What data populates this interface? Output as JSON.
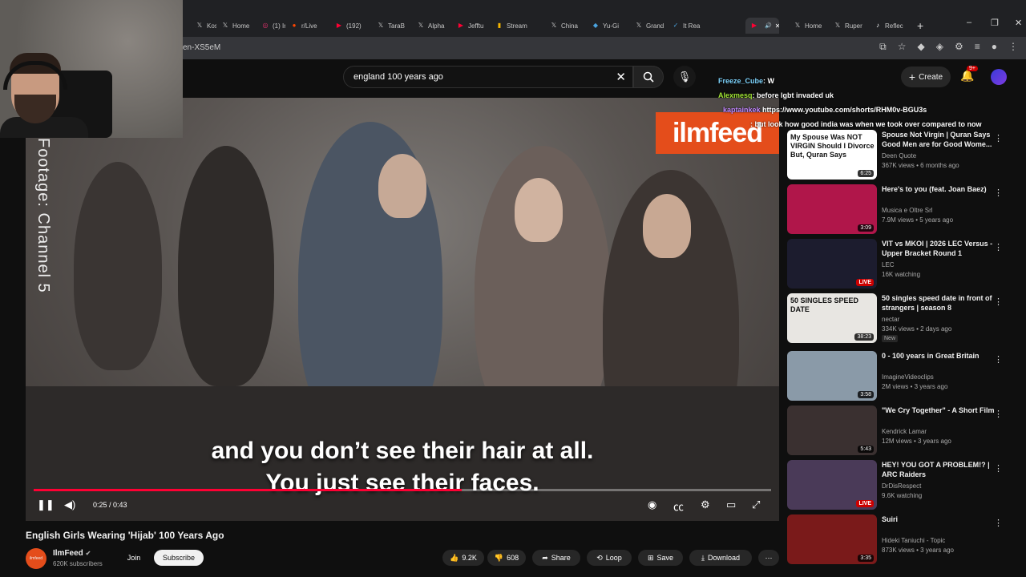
{
  "browser": {
    "tabs": [
      {
        "label": "Koshe",
        "icon": "x-logo-icon",
        "color": "#cccccc"
      },
      {
        "label": "Home",
        "icon": "x-logo-icon",
        "color": "#cccccc"
      },
      {
        "label": "(1) Ins",
        "icon": "instagram-icon",
        "color": "#e1306c"
      },
      {
        "label": "r/Live",
        "icon": "reddit-icon",
        "color": "#ff4500"
      },
      {
        "label": "(192)",
        "icon": "youtube-icon",
        "color": "#ff0033"
      },
      {
        "label": "TaraB",
        "icon": "x-logo-icon",
        "color": "#cccccc"
      },
      {
        "label": "Alpha",
        "icon": "x-logo-icon",
        "color": "#cccccc"
      },
      {
        "label": "Jefftu",
        "icon": "youtube-icon",
        "color": "#ff0033"
      },
      {
        "label": "Stream",
        "icon": "chart-icon",
        "color": "#f4b400"
      },
      {
        "label": "China",
        "icon": "x-logo-icon",
        "color": "#cccccc"
      },
      {
        "label": "Yu-Gi",
        "icon": "yugioh-icon",
        "color": "#4aa3df"
      },
      {
        "label": "Grand",
        "icon": "x-logo-icon",
        "color": "#cccccc"
      },
      {
        "label": "It Rea",
        "icon": "check-icon",
        "color": "#4aa3df"
      },
      {
        "label": "",
        "icon": "youtube-icon",
        "color": "#ff0033",
        "active": true
      },
      {
        "label": "Home",
        "icon": "x-logo-icon",
        "color": "#cccccc"
      },
      {
        "label": "Ruper",
        "icon": "x-logo-icon",
        "color": "#cccccc"
      },
      {
        "label": "Reflec",
        "icon": "tiktok-icon",
        "color": "#ffffff"
      }
    ],
    "new_tab": "+",
    "url_fragment": "en-XS5eM"
  },
  "header": {
    "search_value": "england 100 years ago",
    "create_label": "Create",
    "notification_count": "9+"
  },
  "chat": [
    {
      "user": "Freeze_Cube",
      "message": ": W",
      "user_color": "#7dd3fc"
    },
    {
      "user": "Alexmesq",
      "message": ": before lgbt invaded uk",
      "user_color": "#a3e635"
    },
    {
      "user": "kaptainkek",
      "message": "https://www.youtube.com/shorts/RHM0v-BGU3s",
      "user_color": "#c084fc"
    },
    {
      "user": "",
      "message": ": but look how good india was when we took over compared to now",
      "user_color": "#ffffff"
    }
  ],
  "video": {
    "watermark": "ilmfeed",
    "side_text": "Footage: Channel 5",
    "caption_line1": "and you don’t see their hair at all.",
    "caption_line2": "You just see their faces.",
    "time": "0:25 / 0:43",
    "progress": 0.58
  },
  "details": {
    "title": "English Girls Wearing 'Hijab' 100 Years Ago",
    "channel": "IlmFeed",
    "avatar_text": "ilmfeed",
    "subscribers": "620K subscribers",
    "join_label": "Join",
    "subscribe_label": "Subscribe",
    "likes": "9.2K",
    "dislikes": "608",
    "share_label": "Share",
    "loop_label": "Loop",
    "save_label": "Save",
    "download_label": "Download"
  },
  "recommendations": [
    {
      "title": "Spouse Not Virgin | Quran Says Good Men are for Good Wome...",
      "channel": "Deen Quote",
      "meta": "367K views • 6 months ago",
      "duration": "6:25",
      "thumb_text": "My Spouse Was NOT VIRGIN Should I Divorce But, Quran Says",
      "thumb_color": "#ffffff"
    },
    {
      "title": "Here's to you (feat. Joan Baez)",
      "channel": "Musica e Oltre Srl",
      "meta": "7.9M views • 5 years ago",
      "duration": "3:09",
      "thumb_text": "",
      "thumb_color": "#b0164a"
    },
    {
      "title": "VIT vs MKOI | 2026 LEC Versus - Upper Bracket Round 1",
      "channel": "LEC",
      "meta": "16K watching",
      "live": "LIVE",
      "thumb_text": "",
      "thumb_color": "#1c1c2e"
    },
    {
      "title": "50 singles speed date in front of strangers | season 8",
      "channel": "nectar",
      "meta": "334K views • 2 days ago",
      "badge": "New",
      "duration": "38:23",
      "thumb_text": "50 SINGLES SPEED DATE",
      "thumb_color": "#e8e6e2"
    },
    {
      "title": "0 - 100 years in Great Britain",
      "channel": "ImagineVideoclips",
      "meta": "2M views • 3 years ago",
      "duration": "3:58",
      "thumb_text": "",
      "thumb_color": "#8a9aa8"
    },
    {
      "title": "\"We Cry Together\" - A Short Film",
      "channel": "Kendrick Lamar",
      "meta": "12M views • 3 years ago",
      "duration": "5:43",
      "thumb_text": "",
      "thumb_color": "#3a3030"
    },
    {
      "title": "HEY! YOU GOT A PROBLEM!? | ARC Raiders",
      "channel": "DrDisRespect",
      "meta": "9.6K watching",
      "live": "LIVE",
      "thumb_text": "",
      "thumb_color": "#4a3a58"
    },
    {
      "title": "Suiri",
      "channel": "Hideki Taniuchi - Topic",
      "meta": "873K views • 3 years ago",
      "duration": "3:35",
      "thumb_text": "",
      "thumb_color": "#7a1a1a"
    }
  ]
}
